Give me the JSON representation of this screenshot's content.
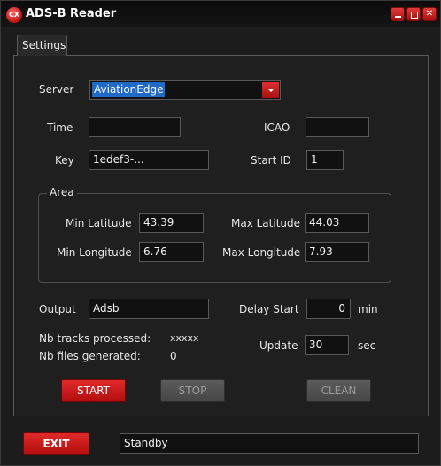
{
  "app": {
    "title": "ADS-B Reader",
    "icon_text": "CX"
  },
  "tabs": [
    {
      "label": "Settings"
    }
  ],
  "server": {
    "label": "Server",
    "value": "AviationEdge"
  },
  "time": {
    "label": "Time",
    "value": ""
  },
  "icao": {
    "label": "ICAO",
    "value": ""
  },
  "key": {
    "label": "Key",
    "value": "1edef3-..."
  },
  "start_id": {
    "label": "Start ID",
    "value": "1"
  },
  "area": {
    "title": "Area",
    "min_latitude": {
      "label": "Min Latitude",
      "value": "43.39"
    },
    "max_latitude": {
      "label": "Max Latitude",
      "value": "44.03"
    },
    "min_longitude": {
      "label": "Min Longitude",
      "value": "6.76"
    },
    "max_longitude": {
      "label": "Max Longitude",
      "value": "7.93"
    }
  },
  "output": {
    "label": "Output",
    "value": "Adsb"
  },
  "delay_start": {
    "label": "Delay Start",
    "value": "0",
    "unit": "min"
  },
  "update": {
    "label": "Update",
    "value": "30",
    "unit": "sec"
  },
  "stats": {
    "tracks_label": "Nb tracks processed:",
    "tracks_value": "xxxxx",
    "files_label": "Nb files generated:",
    "files_value": "0"
  },
  "buttons": {
    "start": "START",
    "stop": "STOP",
    "clean": "CLEAN",
    "exit": "EXIT"
  },
  "status": "Standby",
  "colors": {
    "accent": "#c41616",
    "selection": "#1f69c9",
    "background": "#1c1c1c"
  }
}
